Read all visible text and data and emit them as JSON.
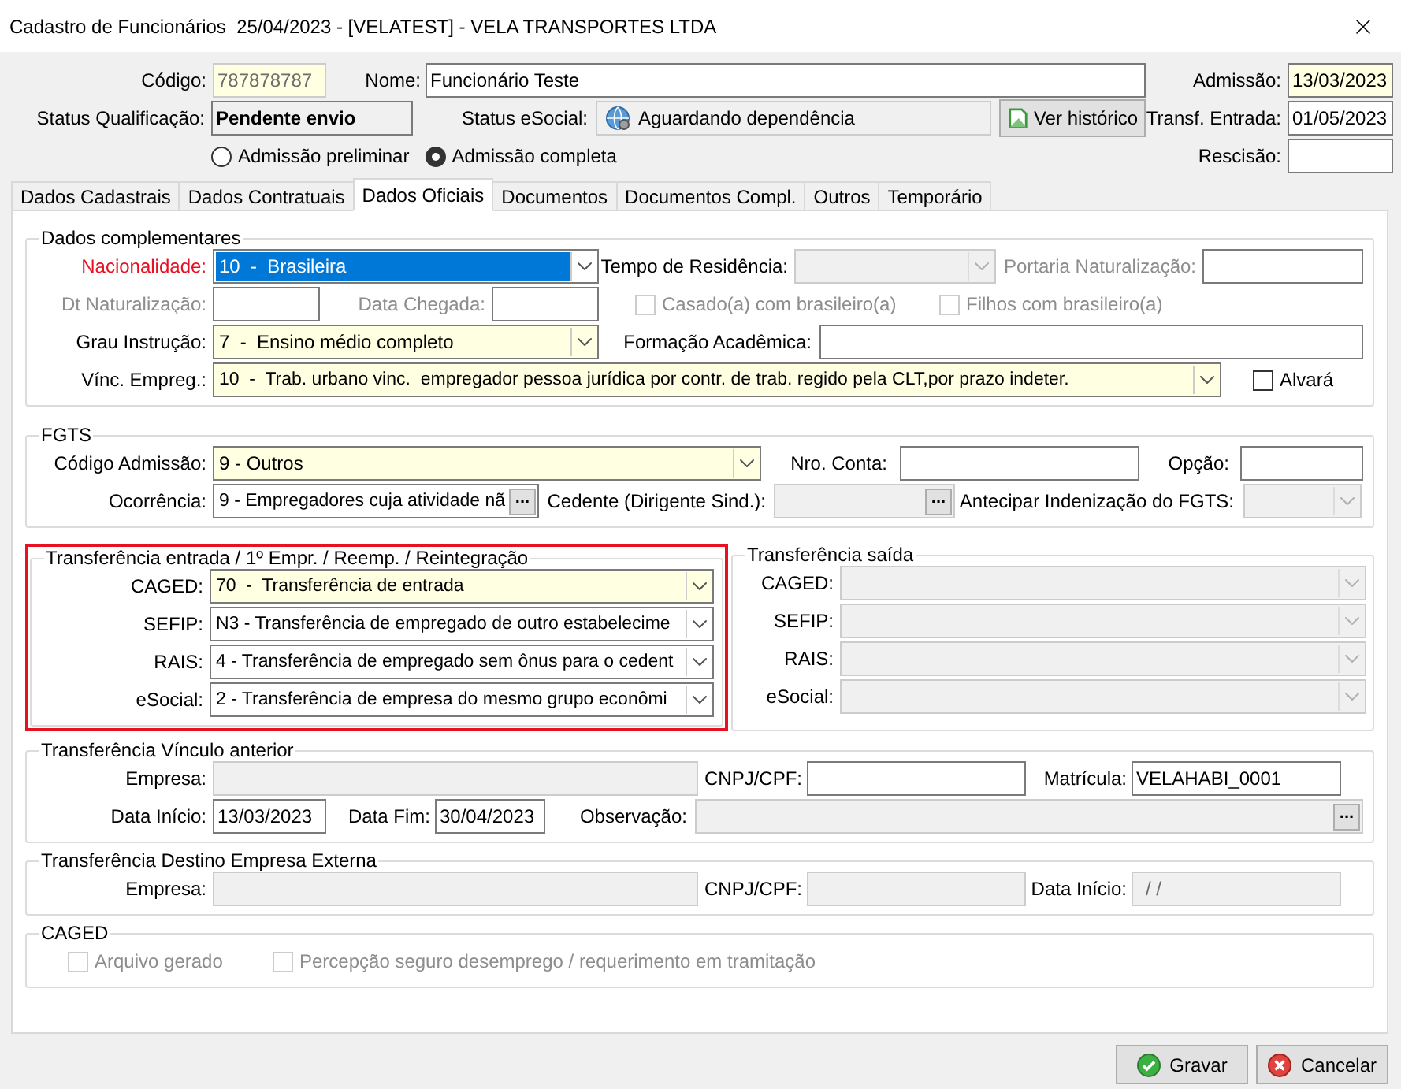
{
  "window": {
    "title": "Cadastro de Funcionários  25/04/2023 - [VELATEST] - VELA TRANSPORTES LTDA"
  },
  "header": {
    "codigo": {
      "label": "Código:",
      "value": "787878787",
      "kind": "text",
      "disabled": true,
      "highlighted": true
    },
    "nome": {
      "label": "Nome:",
      "value": "Funcionário Teste",
      "kind": "text"
    },
    "admissao": {
      "label": "Admissão:",
      "value": "13/03/2023",
      "kind": "text",
      "highlighted": true
    },
    "status_qualificacao": {
      "label": "Status Qualificação:",
      "value": "Pendente envio"
    },
    "status_esocial": {
      "label": "Status eSocial:",
      "value": "Aguardando dependência"
    },
    "ver_historico": {
      "label": "Ver histórico"
    },
    "transf_entrada": {
      "label": "Transf. Entrada:",
      "value": "01/05/2023",
      "kind": "text"
    },
    "admission_type": [
      {
        "label": "Admissão preliminar",
        "selected": false
      },
      {
        "label": "Admissão completa",
        "selected": true
      }
    ],
    "rescisao": {
      "label": "Rescisão:",
      "kind": "text"
    }
  },
  "tabs": [
    {
      "label": "Dados Cadastrais",
      "selected": false
    },
    {
      "label": "Dados Contratuais",
      "selected": false
    },
    {
      "label": "Dados Oficiais",
      "selected": true
    },
    {
      "label": "Documentos",
      "selected": false
    },
    {
      "label": "Documentos Compl.",
      "selected": false
    },
    {
      "label": "Outros",
      "selected": false
    },
    {
      "label": "Temporário",
      "selected": false
    }
  ],
  "dados_complementares": {
    "title": "Dados complementares",
    "nacionalidade": {
      "label": "Nacionalidade:",
      "value": "10  -  Brasileira",
      "kind": "combo",
      "alert": true,
      "focused": true
    },
    "tempo_residencia": {
      "label": "Tempo de Residência:",
      "kind": "combo",
      "disabled": true
    },
    "portaria": {
      "label": "Portaria Naturalização:",
      "kind": "text",
      "label_disabled": true
    },
    "dt_naturalizacao": {
      "label": "Dt Naturalização:",
      "kind": "text",
      "label_disabled": true
    },
    "data_chegada": {
      "label": "Data Chegada:",
      "kind": "text",
      "label_disabled": true
    },
    "casado": {
      "label": "Casado(a) com brasileiro(a)",
      "checked": false,
      "disabled": true
    },
    "filhos": {
      "label": "Filhos com brasileiro(a)",
      "checked": false,
      "disabled": true
    },
    "grau": {
      "label": "Grau Instrução:",
      "value": "7  -  Ensino médio completo",
      "kind": "combo",
      "highlighted": true
    },
    "formacao": {
      "label": "Formação Acadêmica:",
      "kind": "text"
    },
    "vinc": {
      "label": "Vínc. Empreg.:",
      "value": "10  -  Trab. urbano vinc.  empregador pessoa jurídica por contr. de trab. regido pela CLT,por prazo indeter.",
      "kind": "combo",
      "highlighted": true
    },
    "alvara": {
      "label": "Alvará",
      "checked": false,
      "disabled": false
    }
  },
  "fgts": {
    "title": "FGTS",
    "codigo_admissao": {
      "label": "Código Admissão:",
      "value": "9 - Outros",
      "kind": "combo",
      "highlighted": true
    },
    "nro_conta": {
      "label": "Nro. Conta:",
      "kind": "text"
    },
    "opcao": {
      "label": "Opção:",
      "kind": "text"
    },
    "ocorrencia": {
      "label": "Ocorrência:",
      "value": "9 - Empregadores cuja atividade nã",
      "kind": "lookup",
      "button": "..."
    },
    "cedente": {
      "label": "Cedente (Dirigente Sind.):",
      "kind": "lookup",
      "button": "...",
      "disabled": true
    },
    "antecipar": {
      "label": "Antecipar Indenização do FGTS:",
      "kind": "combo",
      "disabled": true
    }
  },
  "transferencia_entrada": {
    "title": "Transferência entrada / 1º Empr. / Reemp. / Reintegração",
    "marked": true,
    "fields": [
      {
        "label": "CAGED:",
        "value": "70  -  Transferência de entrada",
        "kind": "combo",
        "highlighted": true
      },
      {
        "label": "SEFIP:",
        "value": "N3 - Transferência de empregado de outro estabelecime",
        "kind": "combo"
      },
      {
        "label": "RAIS:",
        "value": "4 - Transferência de empregado sem ônus para o cedent",
        "kind": "combo"
      },
      {
        "label": "eSocial:",
        "value": "2 - Transferência de empresa do mesmo grupo econômi",
        "kind": "combo"
      }
    ]
  },
  "transferencia_saida": {
    "title": "Transferência saída",
    "fields": [
      {
        "label": "CAGED:",
        "kind": "combo",
        "disabled": true
      },
      {
        "label": "SEFIP:",
        "kind": "combo",
        "disabled": true
      },
      {
        "label": "RAIS:",
        "kind": "combo",
        "disabled": true
      },
      {
        "label": "eSocial:",
        "kind": "combo",
        "disabled": true
      }
    ]
  },
  "vinculo_anterior": {
    "title": "Transferência Vínculo anterior",
    "empresa": {
      "label": "Empresa:",
      "kind": "text",
      "disabled": true
    },
    "cnpj": {
      "label": "CNPJ/CPF:",
      "kind": "text"
    },
    "matricula": {
      "label": "Matrícula:",
      "value": "VELAHABI_0001",
      "kind": "text"
    },
    "data_inicio": {
      "label": "Data Início:",
      "value": "13/03/2023",
      "kind": "text"
    },
    "data_fim": {
      "label": "Data Fim:",
      "value": "30/04/2023",
      "kind": "text"
    },
    "observacao": {
      "label": "Observação:",
      "kind": "lookup",
      "button": "...",
      "disabled": true
    }
  },
  "destino_externa": {
    "title": "Transferência Destino Empresa Externa",
    "empresa": {
      "label": "Empresa:",
      "kind": "text",
      "disabled": true
    },
    "cnpj": {
      "label": "CNPJ/CPF:",
      "kind": "text",
      "disabled": true
    },
    "data_inicio": {
      "label": "Data Início:",
      "value": "/ /",
      "kind": "text",
      "disabled": true
    }
  },
  "caged": {
    "title": "CAGED",
    "arquivo": {
      "label": "Arquivo gerado",
      "checked": false,
      "disabled": true
    },
    "percepcao": {
      "label": "Percepção seguro desemprego / requerimento em tramitação",
      "checked": false,
      "disabled": true
    }
  },
  "buttons": [
    {
      "label": "Gravar",
      "kind": "save"
    },
    {
      "label": "Cancelar",
      "kind": "cancel"
    }
  ]
}
